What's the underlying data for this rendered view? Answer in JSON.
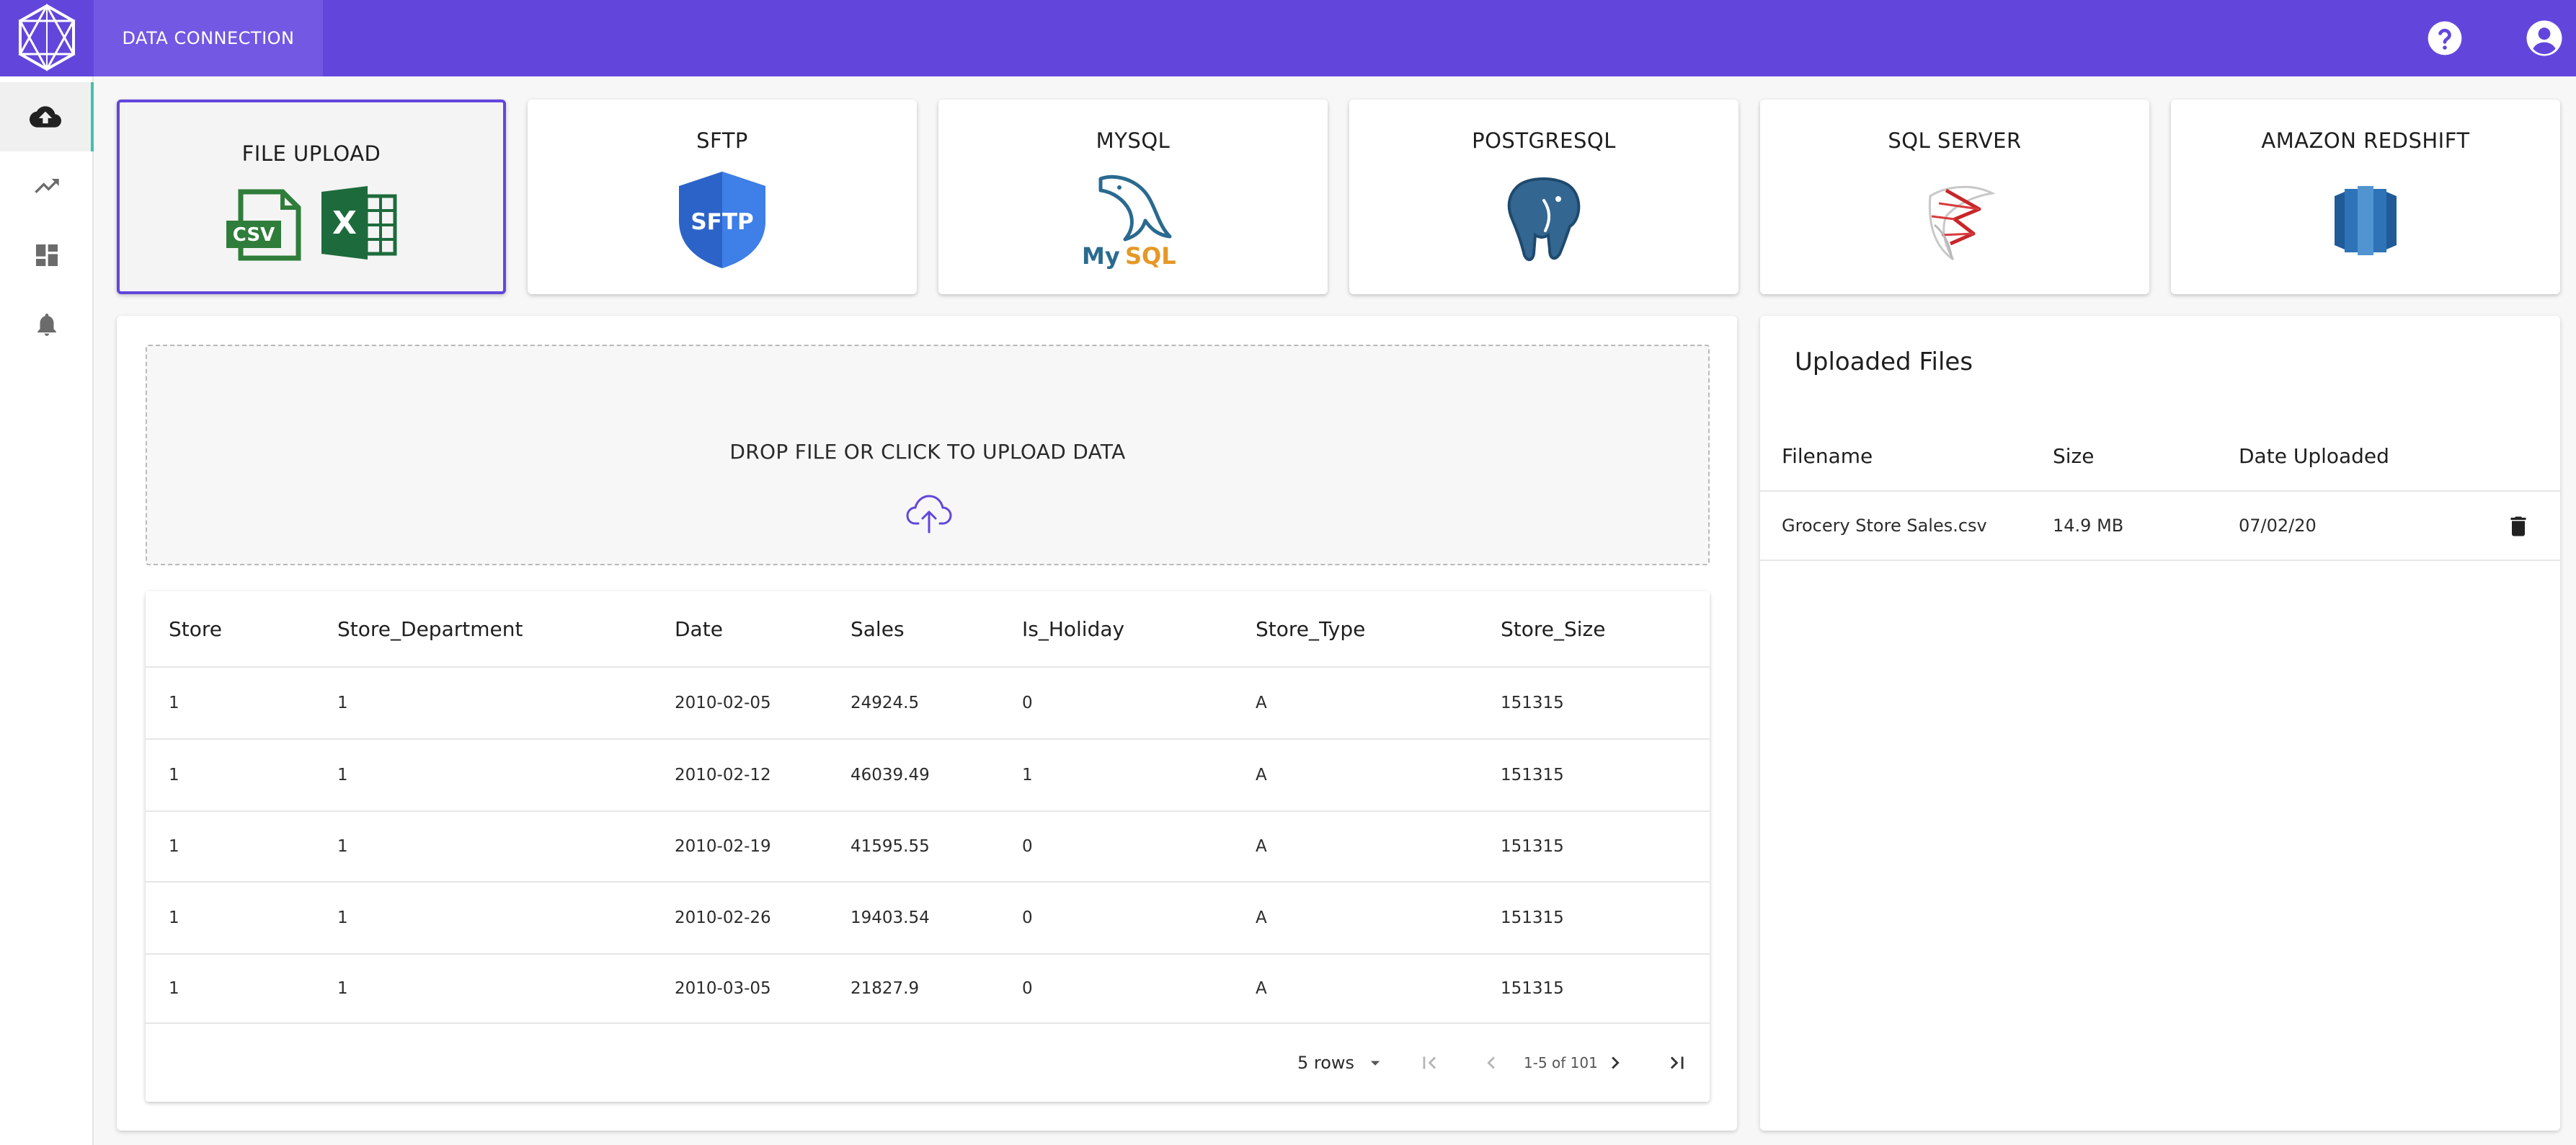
{
  "appbar": {
    "active_tab": "DATA CONNECTION",
    "help_icon": "help-circle-icon",
    "account_icon": "account-circle-icon",
    "logo_icon": "geometric-logo-icon",
    "color": "#6246dc"
  },
  "rail": {
    "items": [
      {
        "icon": "cloud-upload-icon",
        "active": true
      },
      {
        "icon": "trending-up-icon",
        "active": false
      },
      {
        "icon": "dashboard-icon",
        "active": false
      },
      {
        "icon": "bell-icon",
        "active": false
      }
    ],
    "active_accent": "#3fc1ad"
  },
  "sources": [
    {
      "label": "FILE UPLOAD",
      "icon": "csv-excel-icon",
      "selected": true
    },
    {
      "label": "SFTP",
      "icon": "sftp-shield-icon",
      "badge": "SFTP",
      "selected": false
    },
    {
      "label": "MYSQL",
      "icon": "mysql-dolphin-icon",
      "wordmark_my": "My",
      "wordmark_sql": "SQL",
      "selected": false
    },
    {
      "label": "POSTGRESQL",
      "icon": "postgresql-elephant-icon",
      "selected": false
    },
    {
      "label": "SQL SERVER",
      "icon": "sql-server-icon",
      "selected": false
    },
    {
      "label": "AMAZON REDSHIFT",
      "icon": "redshift-icon",
      "selected": false
    }
  ],
  "file_icon_texts": {
    "csv": "CSV",
    "excel": "X"
  },
  "dropzone": {
    "text": "DROP FILE OR CLICK TO UPLOAD DATA",
    "icon": "cloud-upload-outline-icon"
  },
  "preview_table": {
    "columns": [
      "Store",
      "Store_Department",
      "Date",
      "Sales",
      "Is_Holiday",
      "Store_Type",
      "Store_Size"
    ],
    "rows": [
      [
        "1",
        "1",
        "2010-02-05",
        "24924.5",
        "0",
        "A",
        "151315"
      ],
      [
        "1",
        "1",
        "2010-02-12",
        "46039.49",
        "1",
        "A",
        "151315"
      ],
      [
        "1",
        "1",
        "2010-02-19",
        "41595.55",
        "0",
        "A",
        "151315"
      ],
      [
        "1",
        "1",
        "2010-02-26",
        "19403.54",
        "0",
        "A",
        "151315"
      ],
      [
        "1",
        "1",
        "2010-03-05",
        "21827.9",
        "0",
        "A",
        "151315"
      ]
    ],
    "footer": {
      "rows_per_page": "5 rows",
      "range": "1-5 of 101"
    }
  },
  "uploaded_files": {
    "title": "Uploaded Files",
    "columns": [
      "Filename",
      "Size",
      "Date Uploaded"
    ],
    "rows": [
      {
        "filename": "Grocery Store Sales.csv",
        "size": "14.9 MB",
        "date": "07/02/20",
        "delete_icon": "trash-icon"
      }
    ]
  }
}
